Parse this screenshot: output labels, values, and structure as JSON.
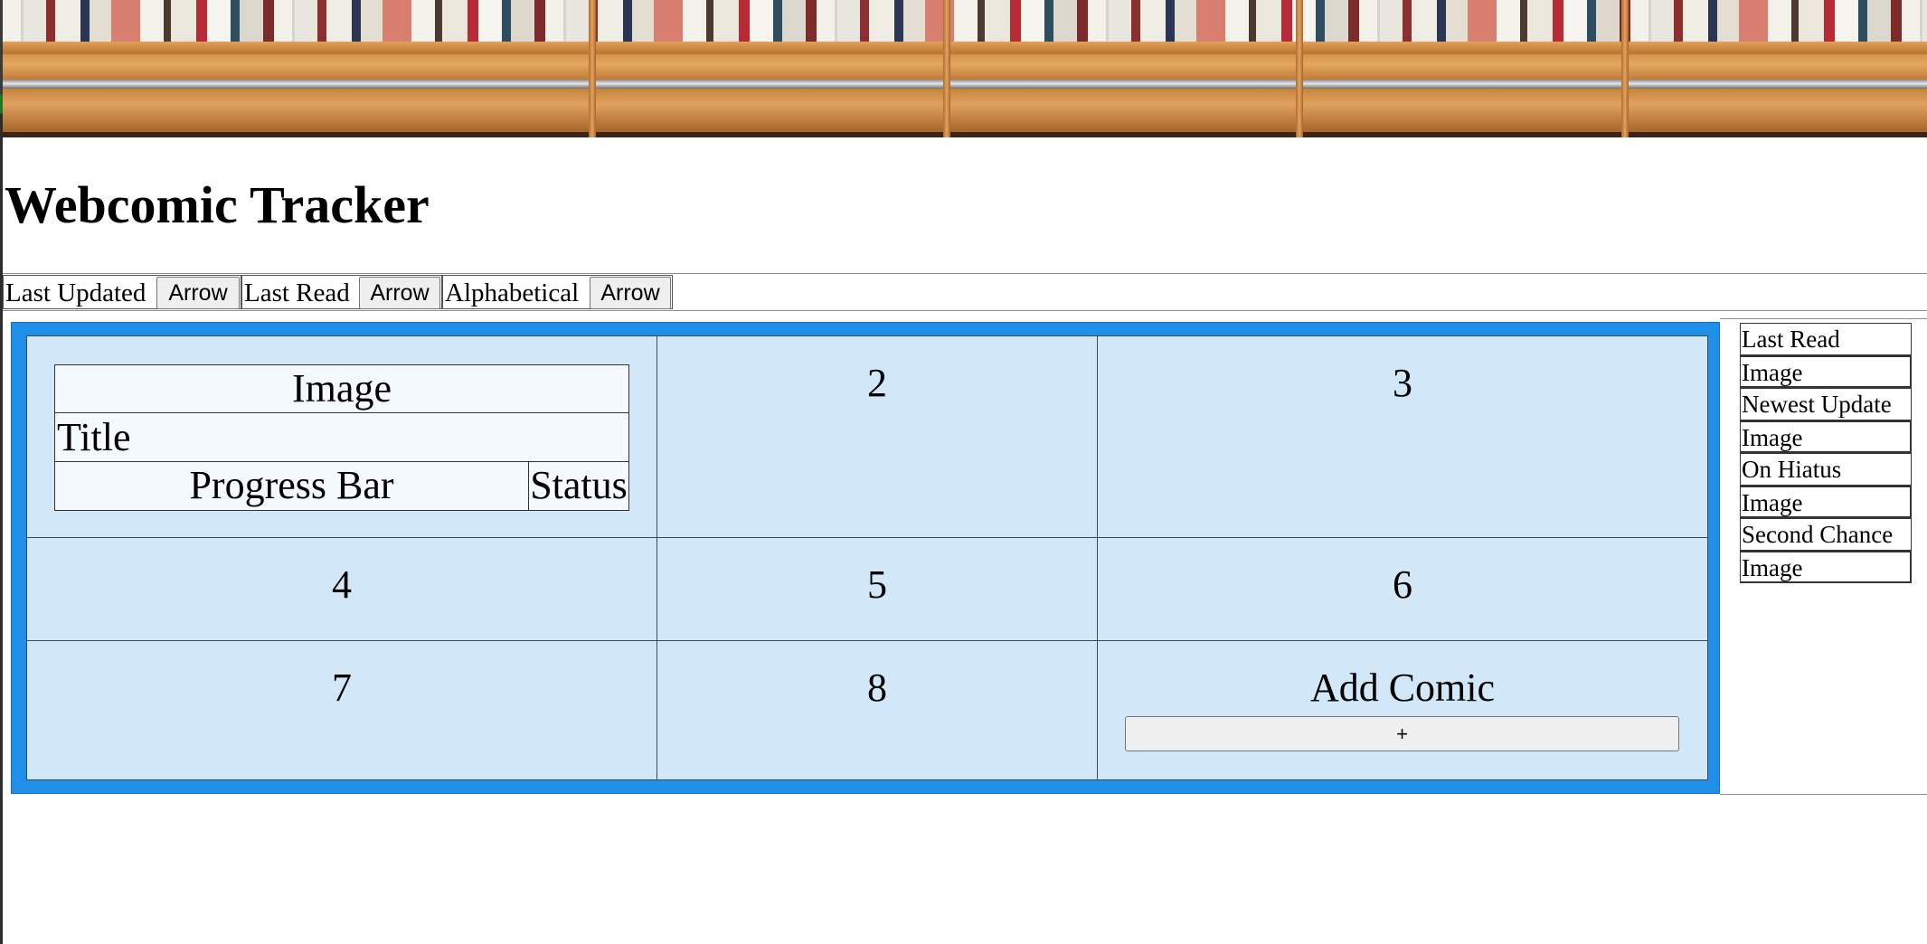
{
  "page": {
    "title": "Webcomic Tracker"
  },
  "sort_bar": {
    "options": [
      {
        "label": "Last Updated",
        "button": "Arrow"
      },
      {
        "label": "Last Read",
        "button": "Arrow"
      },
      {
        "label": "Alphabetical",
        "button": "Arrow"
      }
    ]
  },
  "grid": {
    "card": {
      "image": "Image",
      "title": "Title",
      "progress": "Progress Bar",
      "status": "Status"
    },
    "cells": [
      "2",
      "3",
      "4",
      "5",
      "6",
      "7",
      "8"
    ],
    "add": {
      "label": "Add Comic",
      "button": "+"
    }
  },
  "sidebar": {
    "items": [
      {
        "heading": "Last Read",
        "image": "Image"
      },
      {
        "heading": "Newest Update",
        "image": "Image"
      },
      {
        "heading": "On Hiatus",
        "image": "Image"
      },
      {
        "heading": "Second Chance",
        "image": "Image"
      }
    ]
  },
  "colors": {
    "grid_border": "#1f8fea",
    "cell_background": "#d2e8f9",
    "card_background": "#f3f9fd"
  }
}
